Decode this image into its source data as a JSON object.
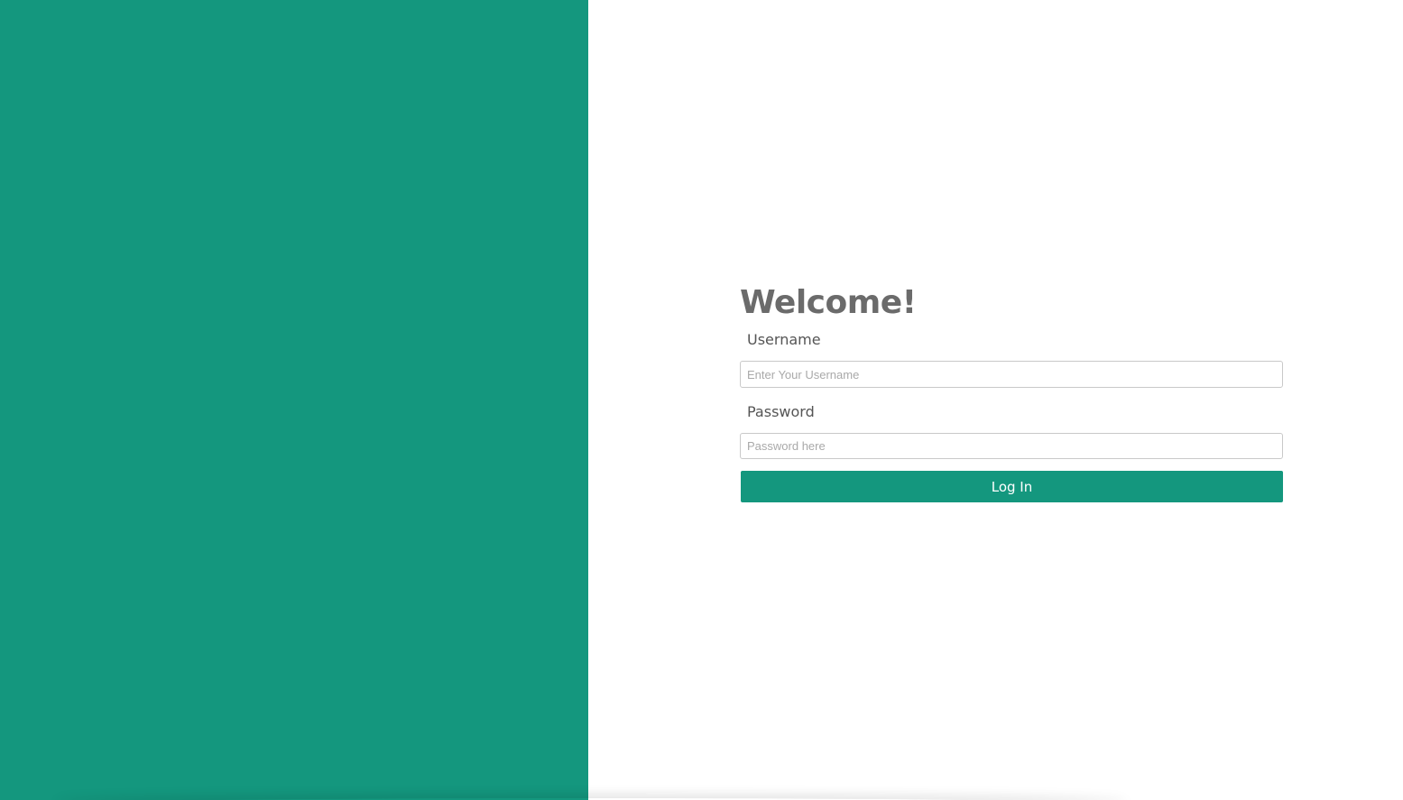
{
  "theme": {
    "accent_color": "#14977e",
    "background_color": "#ffffff",
    "heading_color": "#6b6b6b"
  },
  "login": {
    "heading": "Welcome!",
    "username": {
      "label": "Username",
      "value": "",
      "placeholder": "Enter Your Username"
    },
    "password": {
      "label": "Password",
      "value": "",
      "placeholder": "Password here"
    },
    "submit_label": "Log In"
  }
}
